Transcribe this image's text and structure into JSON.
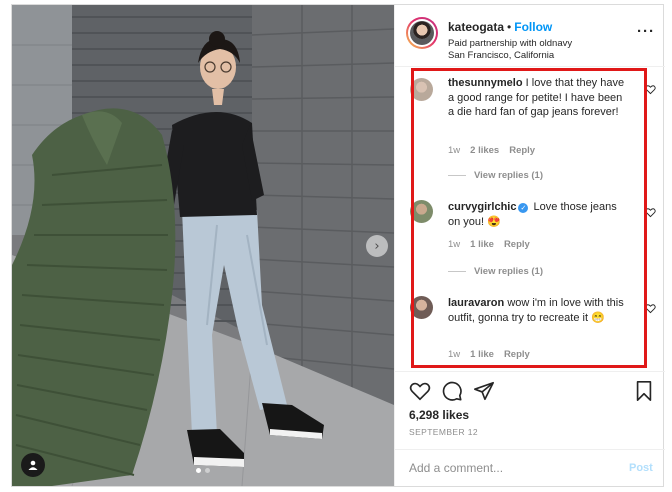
{
  "post": {
    "author": {
      "username": "kateogata",
      "follow_label": "Follow",
      "subtitle": "Paid partnership with oldnavy",
      "location": "San Francisco, California"
    },
    "comments": [
      {
        "username": "thesunnymelo",
        "verified": false,
        "text": "I love that they have a good range for petite! I have been a die hard fan of gap jeans forever!",
        "time": "1w",
        "likes": "2 likes",
        "reply_label": "Reply",
        "view_replies": "View replies (1)",
        "avatar_color": "#b9a99b"
      },
      {
        "username": "curvygirlchic",
        "verified": true,
        "text": "Love those jeans on you! 😍",
        "time": "1w",
        "likes": "1 like",
        "reply_label": "Reply",
        "view_replies": "View replies (1)",
        "avatar_color": "#7e8c6a"
      },
      {
        "username": "lauravaron",
        "verified": false,
        "text": "wow i'm in love with this outfit, gonna try to recreate it 😁",
        "time": "1w",
        "likes": "1 like",
        "reply_label": "Reply",
        "view_replies": "",
        "avatar_color": "#6f5c56"
      }
    ],
    "likes_count": "6,298 likes",
    "date": "SEPTEMBER 12",
    "add_comment_placeholder": "Add a comment...",
    "post_label": "Post",
    "colors": {
      "follow_blue": "#0095f6",
      "highlight_red": "#e01818",
      "muted_gray": "#8e8e8e"
    },
    "icons": [
      "heart-icon",
      "comment-icon",
      "share-icon",
      "bookmark-icon",
      "more-options-icon",
      "next-arrow-icon",
      "user-tag-icon"
    ]
  }
}
